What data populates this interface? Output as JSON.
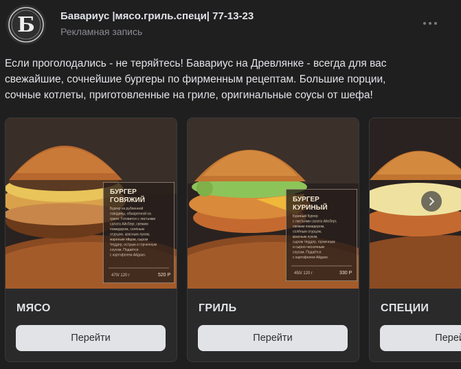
{
  "post": {
    "author": "Бавариус |мясо.гриль.специ| 77-13-23",
    "label": "Рекламная запись",
    "text": "Если проголодались - не теряйтесь! Бавариус на Древлянке - всегда для вас свежайшие, сочнейшие бургеры по фирменным рецептам. Большие порции, сочные котлеты, приготовленные на гриле, оригинальные соусы от шефа!"
  },
  "avatar": {
    "letter": "Б"
  },
  "cards": [
    {
      "label": "МЯСО",
      "button": "Перейти",
      "menu": {
        "line1": "БУРГЕР",
        "line2": "ГОВЯЖИЙ",
        "desc": [
          "Бургер из рубленной",
          "говядины, обжаренной на",
          "гриле. Готовится с листьями",
          "салата Айсберг, свежим",
          "помидором, солёным",
          "огурцом, красным луком,",
          "жареным яйцом, сыром",
          "Чеддер, острым и горчичным",
          "соусом. Подаётся",
          "с картофелем Айдахо."
        ],
        "weight": "470/ 120 г",
        "price": "520 Р"
      }
    },
    {
      "label": "ГРИЛЬ",
      "button": "Перейти",
      "menu": {
        "line1": "БУРГЕР",
        "line2": "КУРИНЫЙ",
        "desc": [
          "Куриный бургер",
          "с листьями салата Айсберг,",
          "свежим помидором,",
          "солёным огурцом,",
          "красным луком,",
          "сыром Чеддер, горчичным",
          "и сырно-чесночным",
          "соусом. Подаётся",
          "с картофелем Айдахо."
        ],
        "weight": "450/ 120 г",
        "price": "330 Р"
      }
    },
    {
      "label": "СПЕЦИИ",
      "button": "Перейти"
    }
  ],
  "icons": {
    "more": "more-horizontal-icon",
    "next": "chevron-right-icon"
  }
}
